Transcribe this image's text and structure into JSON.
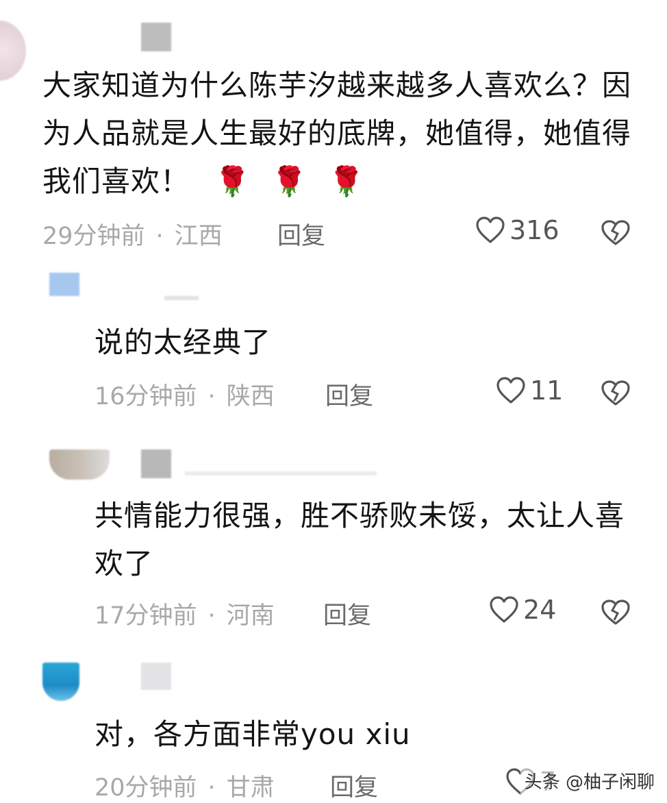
{
  "comments": [
    {
      "text": "大家知道为什么陈芋汐越来越多人喜欢么？因为人品就是人生最好的底牌，她值得，她值得我们喜欢！",
      "emoji": [
        "🌹",
        "🌹",
        "🌹"
      ],
      "time": "29分钟前",
      "location": "江西",
      "reply_label": "回复",
      "likes": "316"
    },
    {
      "text": "说的太经典了",
      "time": "16分钟前",
      "location": "陕西",
      "reply_label": "回复",
      "likes": "11"
    },
    {
      "text": "共情能力很强，胜不骄败未馁，太让人喜欢了",
      "time": "17分钟前",
      "location": "河南",
      "reply_label": "回复",
      "likes": "24"
    },
    {
      "text": "对，各方面非常you xiu",
      "time": "20分钟前",
      "location": "甘肃",
      "reply_label": "回复",
      "likes": "7"
    }
  ],
  "meta_separator": "·",
  "watermark": "头条 @柚子闲聊",
  "icons": {
    "like": "heart-outline-icon",
    "dislike": "broken-heart-icon"
  }
}
